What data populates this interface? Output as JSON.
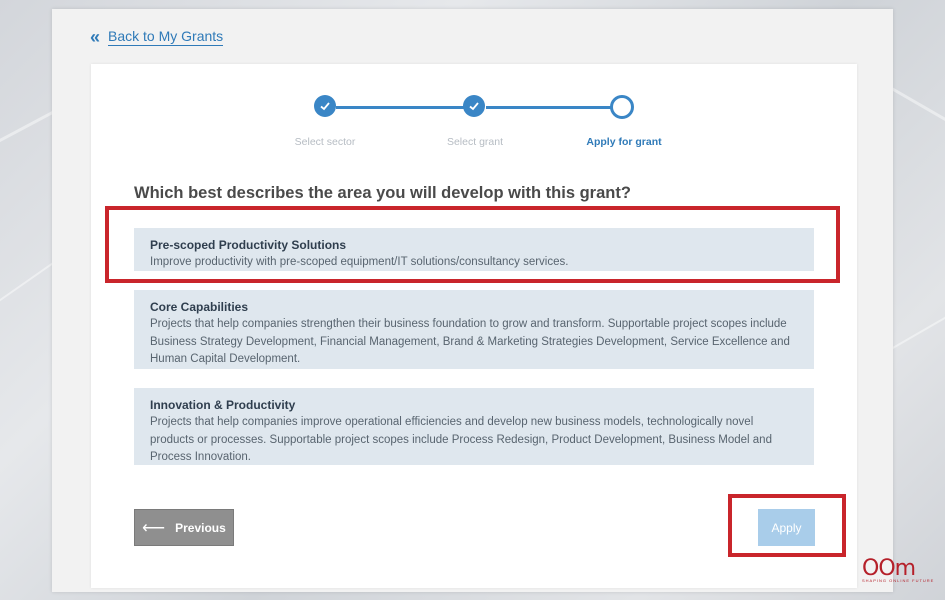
{
  "nav": {
    "back_icon": "double-chevron-left-icon",
    "back_label": "Back to My Grants"
  },
  "stepper": {
    "steps": [
      {
        "label": "Select sector",
        "state": "done"
      },
      {
        "label": "Select grant",
        "state": "done"
      },
      {
        "label": "Apply for grant",
        "state": "current"
      }
    ]
  },
  "question": "Which best describes the area you will develop with this grant?",
  "options": [
    {
      "title": "Pre-scoped Productivity Solutions",
      "description": "Improve productivity with pre-scoped equipment/IT solutions/consultancy services."
    },
    {
      "title": "Core Capabilities",
      "description": "Projects that help companies strengthen their business foundation to grow and transform. Supportable project scopes include Business Strategy Development, Financial Management, Brand & Marketing Strategies Development, Service Excellence and Human Capital Development."
    },
    {
      "title": "Innovation & Productivity",
      "description": "Projects that help companies improve operational efficiencies and develop new business models, technologically novel products or processes. Supportable project scopes include Process Redesign, Product Development, Business Model and Process Innovation."
    }
  ],
  "buttons": {
    "previous_label": "Previous",
    "apply_label": "Apply"
  },
  "colors": {
    "accent": "#3a86c6",
    "highlight": "#c9252b",
    "option_bg": "#dfe7ee",
    "apply_disabled": "#a9cdea"
  },
  "watermark": {
    "logo_text": "OOm",
    "tagline": "SHAPING ONLINE FUTURE"
  }
}
